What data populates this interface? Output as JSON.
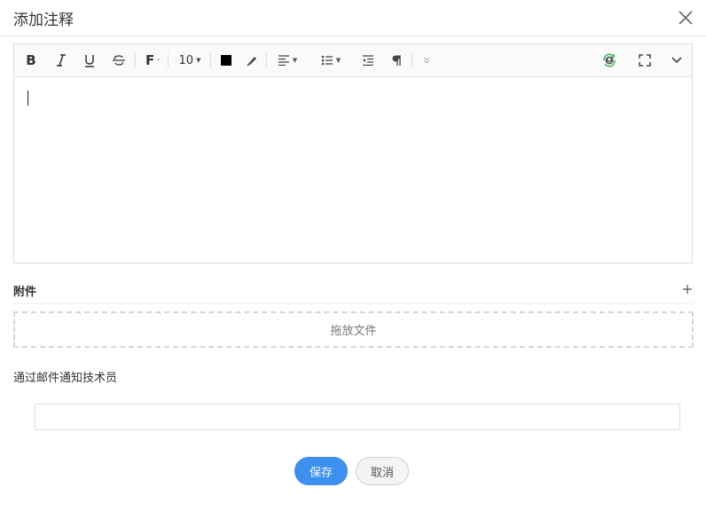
{
  "dialog": {
    "title": "添加注释"
  },
  "toolbar": {
    "font_size": "10",
    "text_color": "#000000"
  },
  "attachments": {
    "label": "附件",
    "dropzone_text": "拖放文件"
  },
  "notify": {
    "label": "通过邮件通知技术员",
    "value": ""
  },
  "actions": {
    "save_label": "保存",
    "cancel_label": "取消"
  },
  "colors": {
    "primary": "#3d8ff0",
    "user_icon": "#36b25a"
  }
}
